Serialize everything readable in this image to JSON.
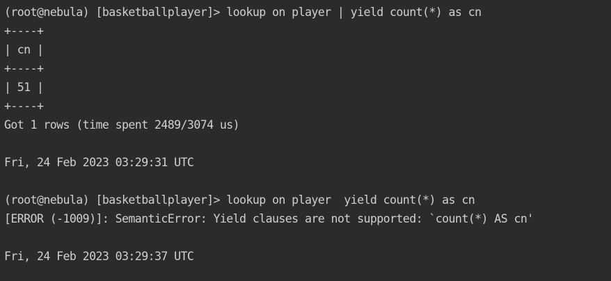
{
  "terminal": {
    "lines": [
      "(root@nebula) [basketballplayer]> lookup on player | yield count(*) as cn",
      "+----+",
      "| cn |",
      "+----+",
      "| 51 |",
      "+----+",
      "Got 1 rows (time spent 2489/3074 us)",
      "",
      "Fri, 24 Feb 2023 03:29:31 UTC",
      "",
      "(root@nebula) [basketballplayer]> lookup on player  yield count(*) as cn",
      "[ERROR (-1009)]: SemanticError: Yield clauses are not supported: `count(*) AS cn'",
      "",
      "Fri, 24 Feb 2023 03:29:37 UTC"
    ]
  },
  "colors": {
    "background": "#2b2b2b",
    "text": "#cfcfcf"
  }
}
